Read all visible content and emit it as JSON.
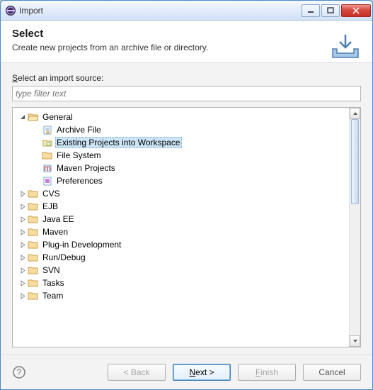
{
  "window": {
    "title": "Import"
  },
  "banner": {
    "heading": "Select",
    "subtitle": "Create new projects from an archive file or directory."
  },
  "filter": {
    "label_pre": "S",
    "label_post": "elect an import source:",
    "placeholder": "type filter text"
  },
  "tree": {
    "root": "General",
    "general_children": [
      {
        "label": "Archive File",
        "icon": "archive"
      },
      {
        "label": "Existing Projects into Workspace",
        "icon": "project",
        "selected": true
      },
      {
        "label": "File System",
        "icon": "folder"
      },
      {
        "label": "Maven Projects",
        "icon": "maven"
      },
      {
        "label": "Preferences",
        "icon": "prefs"
      }
    ],
    "siblings": [
      "CVS",
      "EJB",
      "Java EE",
      "Maven",
      "Plug-in Development",
      "Run/Debug",
      "SVN",
      "Tasks",
      "Team"
    ]
  },
  "buttons": {
    "back": "< Back",
    "next": "Next >",
    "finish": "Finish",
    "cancel": "Cancel"
  }
}
